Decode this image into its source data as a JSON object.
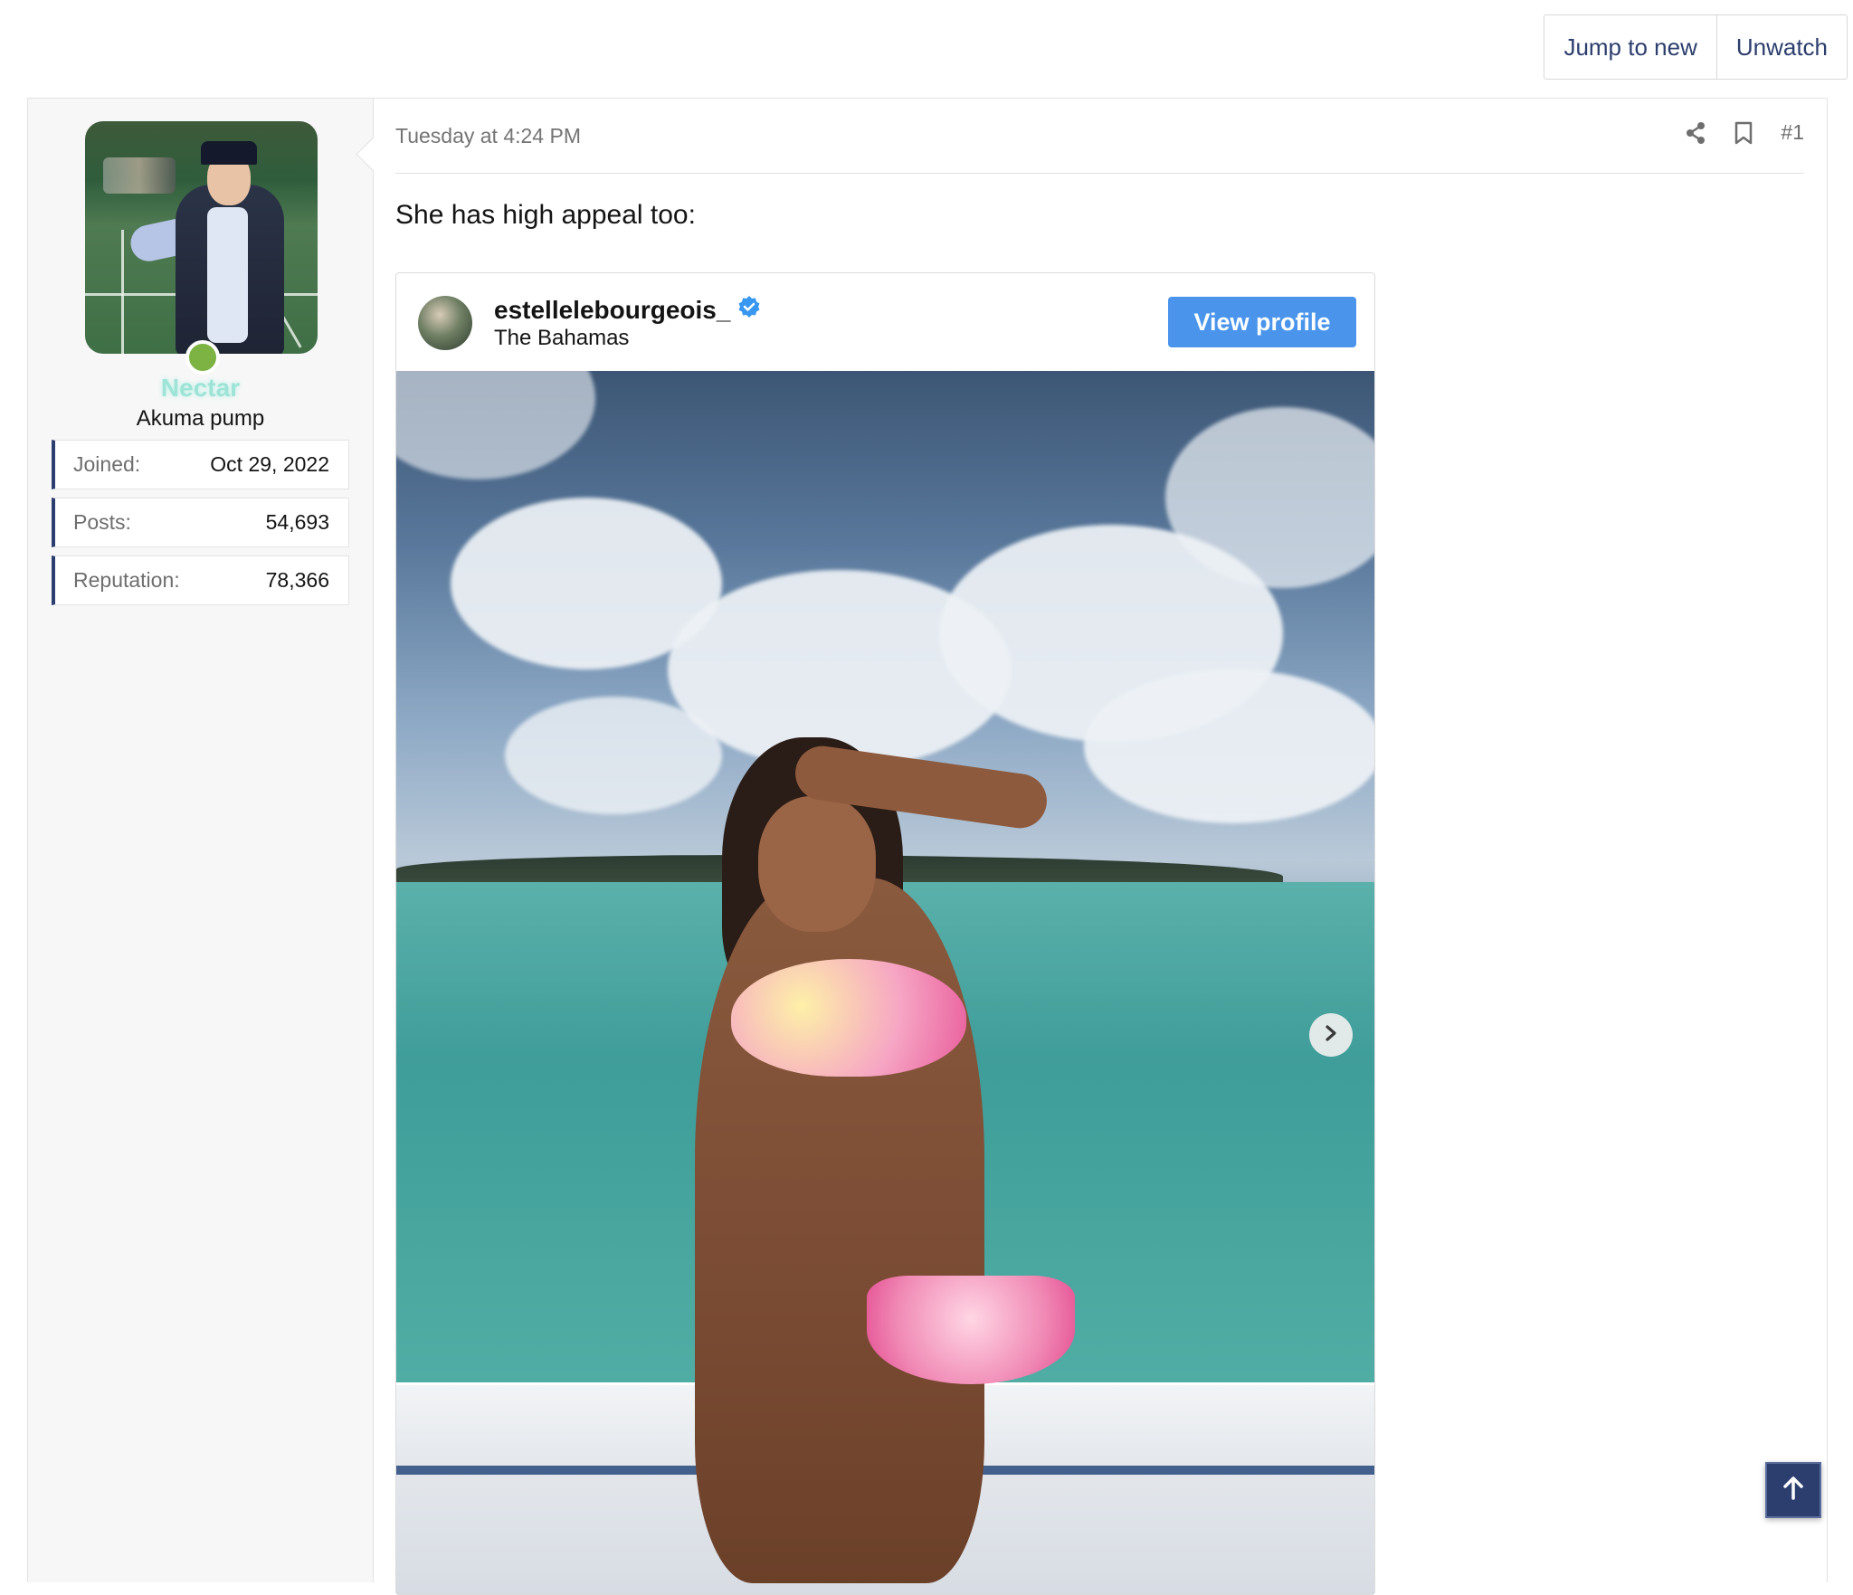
{
  "thread_actions": {
    "jump_to_new": "Jump to new",
    "unwatch": "Unwatch"
  },
  "user": {
    "username": "Nectar",
    "title": "Akuma pump",
    "online": true,
    "stats": [
      {
        "label": "Joined:",
        "value": "Oct 29, 2022"
      },
      {
        "label": "Posts:",
        "value": "54,693"
      },
      {
        "label": "Reputation:",
        "value": "78,366"
      }
    ]
  },
  "post": {
    "date": "Tuesday at 4:24 PM",
    "number": "#1",
    "body": "She has high appeal too:"
  },
  "embed": {
    "account": "estellelebourgeois_",
    "location": "The Bahamas",
    "view_profile": "View profile",
    "verified": true
  },
  "icons": {
    "share": "share-icon",
    "bookmark": "bookmark-icon",
    "next": "chevron-right-icon",
    "scroll_top": "arrow-up-icon",
    "verified": "verified-badge-icon"
  },
  "colors": {
    "accent": "#2c3e6e",
    "button_blue": "#4a95eb",
    "online": "#7cb342",
    "username": "#9ee4d6"
  }
}
